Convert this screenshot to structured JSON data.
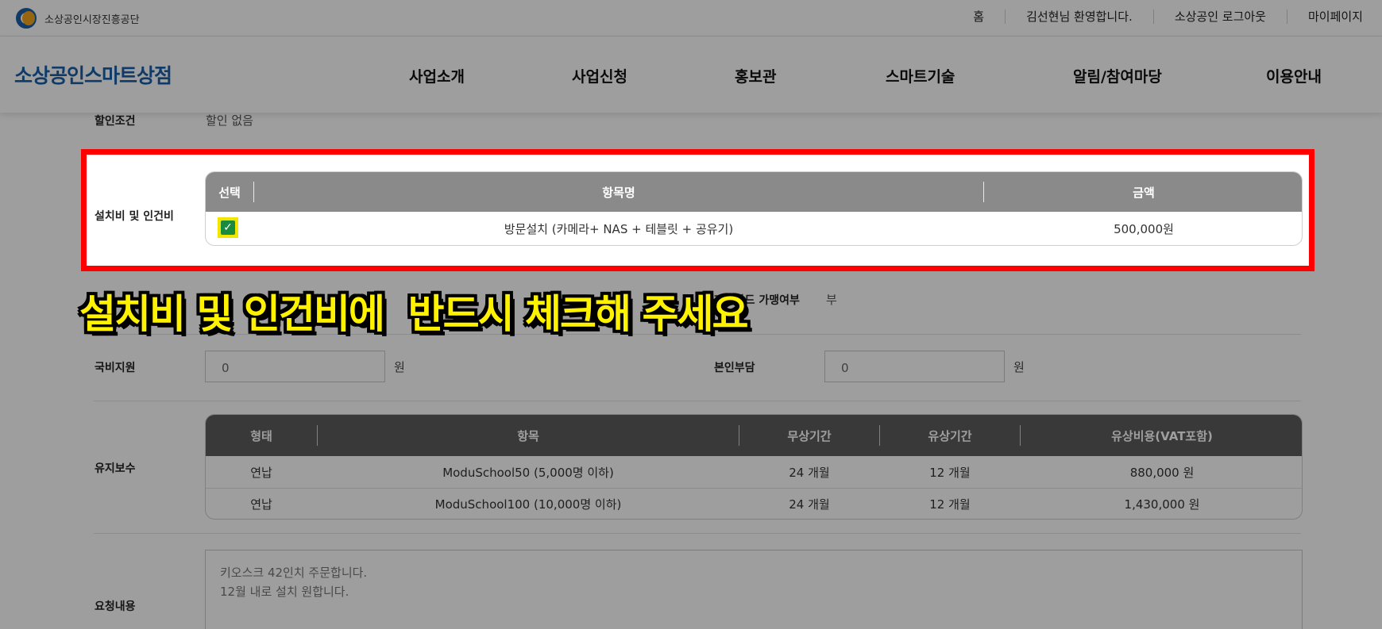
{
  "header": {
    "org_name": "소상공인시장진흥공단",
    "util_links": [
      "홈",
      "김선현님 환영합니다.",
      "소상공인 로그아웃",
      "마이페이지"
    ]
  },
  "nav": {
    "brand": "소상공인스마트상점",
    "menu": [
      "사업소개",
      "사업신청",
      "홍보관",
      "스마트기술",
      "알림/참여마당",
      "이용안내"
    ]
  },
  "form": {
    "discount": {
      "label": "할인조건",
      "value": "할인 없음"
    },
    "install": {
      "label": "설치비 및 인건비",
      "columns": [
        "선택",
        "항목명",
        "금액"
      ],
      "rows": [
        {
          "checked": true,
          "item": "방문설치 (카메라+ NAS + 테블릿 + 공유기)",
          "amount": "500,000원"
        }
      ]
    },
    "card": {
      "label": "제휴카드 가맹여부",
      "value": "부"
    },
    "national_support": {
      "label": "국비지원",
      "value": "0",
      "unit": "원"
    },
    "self_pay": {
      "label": "본인부담",
      "value": "0",
      "unit": "원"
    },
    "maintenance": {
      "label": "유지보수",
      "columns": [
        "형태",
        "항목",
        "무상기간",
        "유상기간",
        "유상비용(VAT포함)"
      ],
      "rows": [
        [
          "연납",
          "ModuSchool50 (5,000명 이하)",
          "24 개월",
          "12 개월",
          "880,000 원"
        ],
        [
          "연납",
          "ModuSchool100 (10,000명 이하)",
          "24 개월",
          "12 개월",
          "1,430,000 원"
        ]
      ]
    },
    "request": {
      "label": "요청내용",
      "lines": [
        "키오스크 42인치 주문합니다.",
        "12월 내로 설치 원합니다."
      ]
    }
  },
  "overlay": {
    "caption": "설치비 및 인건비에  반드시 체크해 주세요",
    "highlight_color": "#ff0000",
    "caption_color": "#fff200"
  }
}
